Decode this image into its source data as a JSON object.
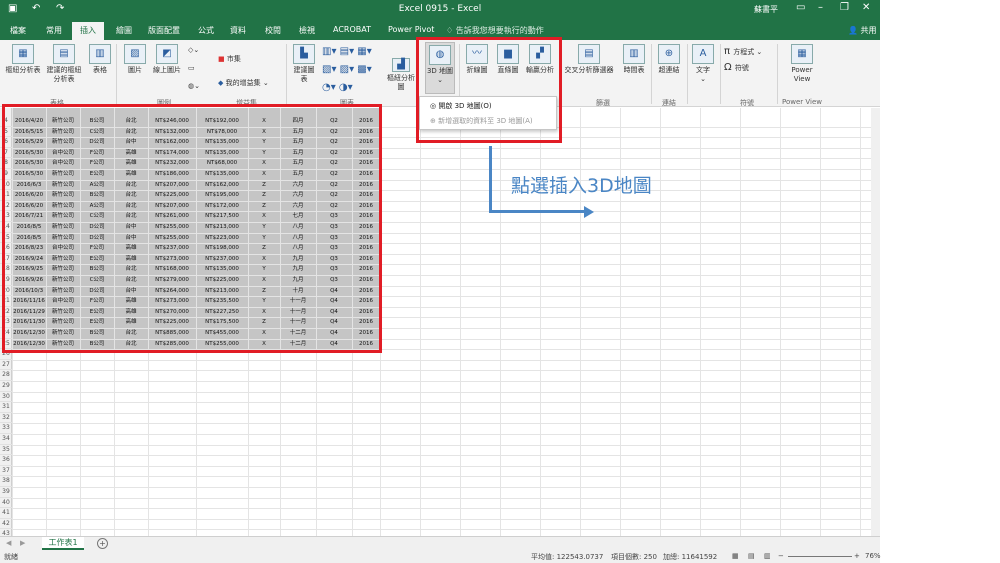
{
  "window": {
    "title": "Excel 0915 - Excel",
    "user": "蘇書平"
  },
  "tabs": [
    "檔案",
    "常用",
    "插入",
    "繪圖",
    "版面配置",
    "公式",
    "資料",
    "校閱",
    "檢視",
    "ACROBAT",
    "Power Pivot"
  ],
  "active_tab": "插入",
  "tell_me": "告訴我您想要執行的動作",
  "share": "共用",
  "ribbon": {
    "pivot": "樞紐分析表",
    "rec_pivot": "建議的樞紐分析表",
    "table": "表格",
    "picture": "圖片",
    "online_picture": "線上圖片",
    "store": "市集",
    "my_addins": "我的增益集",
    "rec_chart": "建議圖表",
    "pivot_chart": "樞紐分析圖",
    "map3d": "3D 地圖",
    "line": "折線圖",
    "column": "直條圖",
    "winloss": "輸贏分析",
    "slicer": "交叉分析篩選器",
    "timeline": "時間表",
    "hyperlink": "超連結",
    "text": "文字",
    "equation": "方程式",
    "symbol": "符號",
    "power_view": "Power View",
    "groups": {
      "tables": "表格",
      "illustrations": "圖例",
      "addins": "增益集",
      "charts": "圖表",
      "filters": "篩選",
      "links": "連結",
      "symbols": "符號",
      "reports": "Power View"
    }
  },
  "dropdown": {
    "open": "開啟 3D 地圖(O)",
    "add": "新增選取的資料至 3D 地圖(A)"
  },
  "annotation": "點選插入3D地圖",
  "rows": [
    [
      "2016/4/20",
      "新竹公司",
      "B公司",
      "台北",
      "NT$246,000",
      "NT$192,000",
      "X",
      "四月",
      "Q2",
      "2016"
    ],
    [
      "2016/5/15",
      "新竹公司",
      "C公司",
      "台北",
      "NT$132,000",
      "NT$78,000",
      "X",
      "五月",
      "Q2",
      "2016"
    ],
    [
      "2016/5/29",
      "新竹公司",
      "D公司",
      "台中",
      "NT$162,000",
      "NT$135,000",
      "Y",
      "五月",
      "Q2",
      "2016"
    ],
    [
      "2016/5/30",
      "台中公司",
      "F公司",
      "高雄",
      "NT$174,000",
      "NT$135,000",
      "Y",
      "五月",
      "Q2",
      "2016"
    ],
    [
      "2016/5/30",
      "台中公司",
      "F公司",
      "高雄",
      "NT$232,000",
      "NT$68,000",
      "X",
      "五月",
      "Q2",
      "2016"
    ],
    [
      "2016/5/30",
      "新竹公司",
      "E公司",
      "高雄",
      "NT$186,000",
      "NT$135,000",
      "X",
      "五月",
      "Q2",
      "2016"
    ],
    [
      "2016/6/3",
      "新竹公司",
      "A公司",
      "台北",
      "NT$207,000",
      "NT$162,000",
      "Z",
      "六月",
      "Q2",
      "2016"
    ],
    [
      "2016/6/20",
      "新竹公司",
      "B公司",
      "台北",
      "NT$225,000",
      "NT$195,000",
      "Z",
      "六月",
      "Q2",
      "2016"
    ],
    [
      "2016/6/20",
      "新竹公司",
      "A公司",
      "台北",
      "NT$207,000",
      "NT$172,000",
      "Z",
      "六月",
      "Q2",
      "2016"
    ],
    [
      "2016/7/21",
      "新竹公司",
      "C公司",
      "台北",
      "NT$261,000",
      "NT$217,500",
      "X",
      "七月",
      "Q3",
      "2016"
    ],
    [
      "2016/8/5",
      "新竹公司",
      "D公司",
      "台中",
      "NT$255,000",
      "NT$213,000",
      "Y",
      "八月",
      "Q3",
      "2016"
    ],
    [
      "2016/8/5",
      "新竹公司",
      "D公司",
      "台中",
      "NT$255,000",
      "NT$223,000",
      "Y",
      "八月",
      "Q3",
      "2016"
    ],
    [
      "2016/8/23",
      "台中公司",
      "F公司",
      "高雄",
      "NT$237,000",
      "NT$198,000",
      "Z",
      "八月",
      "Q3",
      "2016"
    ],
    [
      "2016/9/24",
      "新竹公司",
      "E公司",
      "高雄",
      "NT$273,000",
      "NT$237,000",
      "X",
      "九月",
      "Q3",
      "2016"
    ],
    [
      "2016/9/25",
      "新竹公司",
      "B公司",
      "台北",
      "NT$168,000",
      "NT$135,000",
      "Y",
      "九月",
      "Q3",
      "2016"
    ],
    [
      "2016/9/26",
      "新竹公司",
      "C公司",
      "台北",
      "NT$279,000",
      "NT$225,000",
      "X",
      "九月",
      "Q3",
      "2016"
    ],
    [
      "2016/10/3",
      "新竹公司",
      "D公司",
      "台中",
      "NT$264,000",
      "NT$213,000",
      "Z",
      "十月",
      "Q4",
      "2016"
    ],
    [
      "2016/11/16",
      "台中公司",
      "F公司",
      "高雄",
      "NT$273,000",
      "NT$235,500",
      "Y",
      "十一月",
      "Q4",
      "2016"
    ],
    [
      "2016/11/29",
      "新竹公司",
      "E公司",
      "高雄",
      "NT$270,000",
      "NT$227,250",
      "X",
      "十一月",
      "Q4",
      "2016"
    ],
    [
      "2016/11/30",
      "新竹公司",
      "E公司",
      "高雄",
      "NT$225,000",
      "NT$175,500",
      "Z",
      "十一月",
      "Q4",
      "2016"
    ],
    [
      "2016/12/30",
      "新竹公司",
      "B公司",
      "台北",
      "NT$885,000",
      "NT$455,000",
      "X",
      "十二月",
      "Q4",
      "2016"
    ],
    [
      "2016/12/30",
      "新竹公司",
      "B公司",
      "台北",
      "NT$285,000",
      "NT$255,000",
      "X",
      "十二月",
      "Q4",
      "2016"
    ]
  ],
  "row_numbers": [
    "4",
    "5",
    "6",
    "7",
    "8",
    "9",
    "10",
    "11",
    "12",
    "13",
    "14",
    "15",
    "16",
    "17",
    "18",
    "19",
    "20",
    "21",
    "22",
    "23",
    "24",
    "25",
    "26",
    "27",
    "28",
    "29",
    "30",
    "31",
    "32",
    "33",
    "34",
    "35",
    "36",
    "37",
    "38",
    "39",
    "40",
    "41",
    "42",
    "43"
  ],
  "sheet": {
    "tab": "工作表1"
  },
  "status": {
    "ready": "就緒",
    "avg": "平均值: 122543.0737",
    "count": "項目個數: 250",
    "sum": "加總: 11641592",
    "zoom": "76%"
  }
}
